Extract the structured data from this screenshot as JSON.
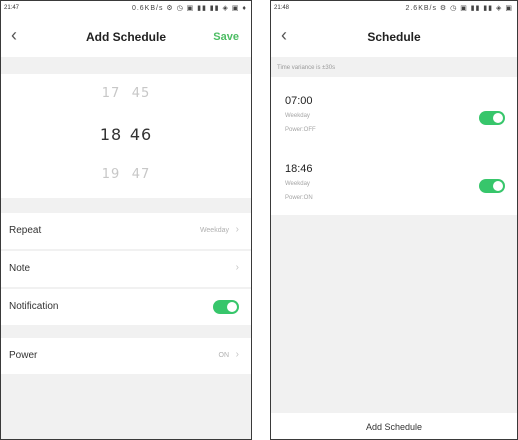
{
  "left": {
    "status": {
      "time": "21:47",
      "icons": "0.6KB/s ⚙ ◷ ▣ ▮▮ ▮▮ ◈ ▣ ♦"
    },
    "nav": {
      "back": "‹",
      "title": "Add Schedule",
      "save": "Save"
    },
    "picker": {
      "prev": {
        "hour": "17",
        "minute": "45"
      },
      "selected": {
        "hour": "18",
        "minute": "46"
      },
      "next": {
        "hour": "19",
        "minute": "47"
      }
    },
    "settings": {
      "repeat": {
        "label": "Repeat",
        "value": "Weekday"
      },
      "note": {
        "label": "Note"
      },
      "notification": {
        "label": "Notification",
        "enabled": true
      },
      "power": {
        "label": "Power",
        "value": "ON"
      }
    }
  },
  "right": {
    "status": {
      "time": "21:48",
      "icons": "2.6KB/s ⚙ ◷ ▣ ▮▮ ▮▮ ◈ ▣"
    },
    "nav": {
      "back": "‹",
      "title": "Schedule"
    },
    "hint": "Time variance is ±30s",
    "schedules": [
      {
        "time": "07:00",
        "repeat": "Weekday",
        "power": "Power:OFF",
        "enabled": true
      },
      {
        "time": "18:46",
        "repeat": "Weekday",
        "power": "Power:ON",
        "enabled": true
      }
    ],
    "add_button": "Add Schedule"
  },
  "colors": {
    "accent": "#4cbd63",
    "toggle_on": "#37c66b",
    "background": "#f1f1f1"
  },
  "icons": {
    "back": "chevron-left-icon",
    "chevron": "chevron-right-icon"
  }
}
